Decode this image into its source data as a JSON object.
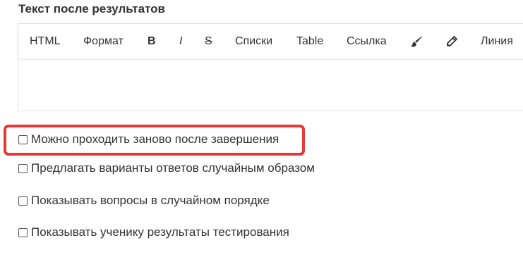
{
  "section": {
    "title": "Текст после результатов"
  },
  "toolbar": {
    "html": "HTML",
    "format": "Формат",
    "bold": "B",
    "italic": "I",
    "strike": "S",
    "lists": "Списки",
    "table": "Table",
    "link": "Ссылка",
    "brush_icon": "brush-icon",
    "pencil_icon": "pencil-icon",
    "line": "Линия"
  },
  "options": [
    {
      "label": "Можно проходить заново после завершения",
      "checked": false,
      "highlighted": true
    },
    {
      "label": "Предлагать варианты ответов случайным образом",
      "checked": false
    },
    {
      "label": "Показывать вопросы в случайном порядке",
      "checked": false
    },
    {
      "label": "Показывать ученику результаты тестирования",
      "checked": false
    }
  ],
  "colors": {
    "highlight": "#e53935",
    "text": "#333333"
  }
}
